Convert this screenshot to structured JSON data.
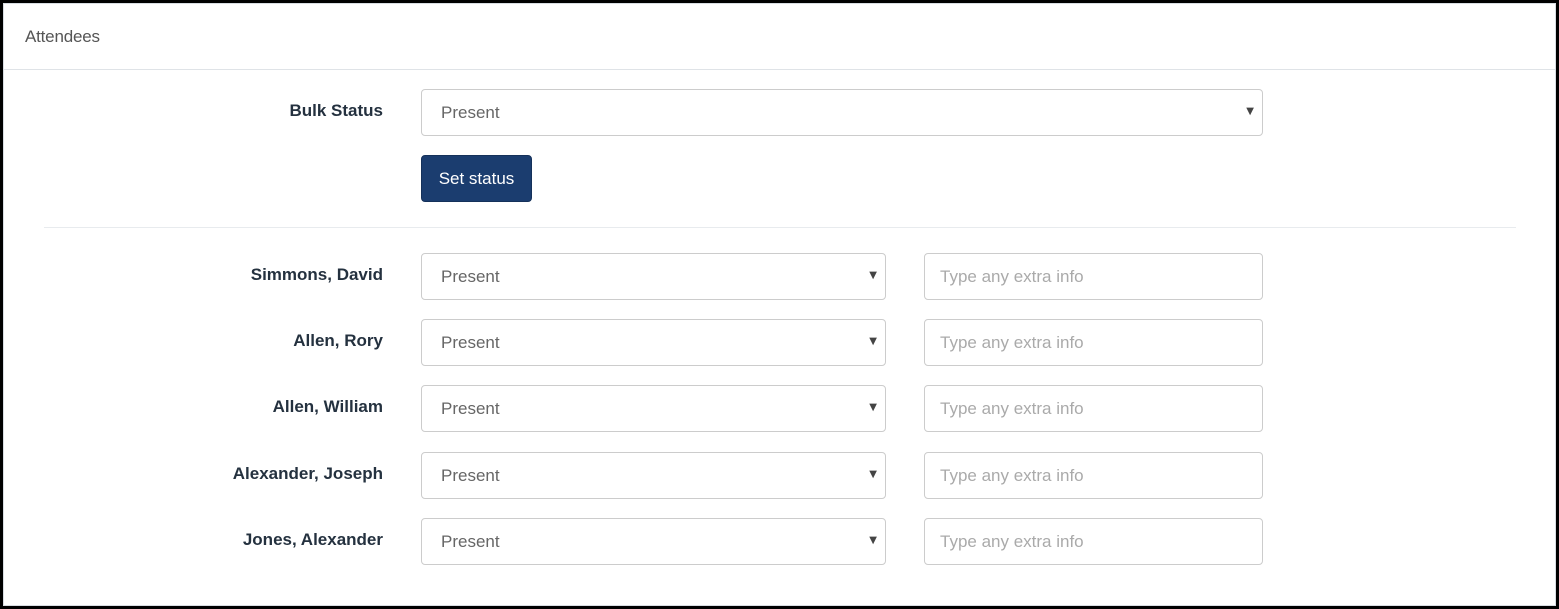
{
  "panel": {
    "title": "Attendees"
  },
  "bulk": {
    "label": "Bulk Status",
    "selected": "Present",
    "button_label": "Set status"
  },
  "attendees": [
    {
      "name": "Simmons, David",
      "status": "Present",
      "info_placeholder": "Type any extra info",
      "info_value": ""
    },
    {
      "name": "Allen, Rory",
      "status": "Present",
      "info_placeholder": "Type any extra info",
      "info_value": ""
    },
    {
      "name": "Allen, William",
      "status": "Present",
      "info_placeholder": "Type any extra info",
      "info_value": ""
    },
    {
      "name": "Alexander, Joseph",
      "status": "Present",
      "info_placeholder": "Type any extra info",
      "info_value": ""
    },
    {
      "name": "Jones, Alexander",
      "status": "Present",
      "info_placeholder": "Type any extra info",
      "info_value": ""
    }
  ],
  "icons": {
    "caret": "▼"
  }
}
